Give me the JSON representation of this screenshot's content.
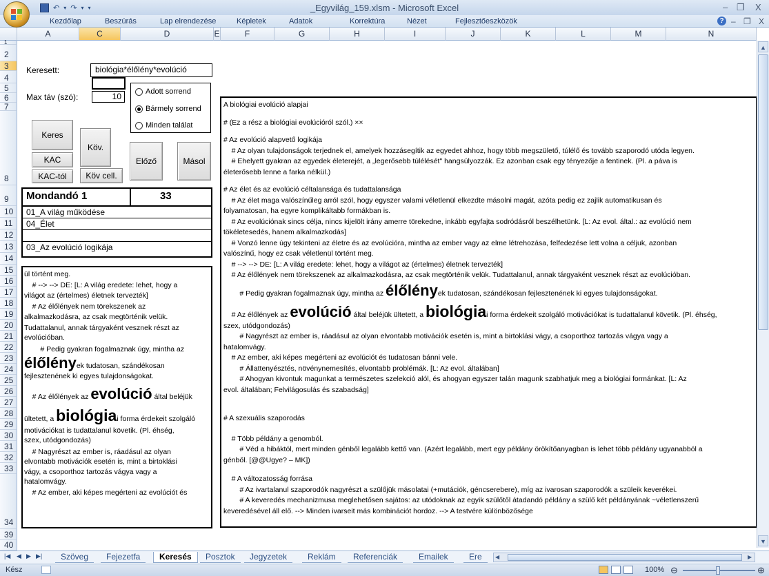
{
  "window": {
    "title": "_Egyvilág_159.xlsm - Microsoft Excel",
    "minimize": "–",
    "restore": "❐",
    "close": "X"
  },
  "ribbon": {
    "tabs": [
      "Kezdőlap",
      "Beszúrás",
      "Lap elrendezése",
      "Képletek",
      "Adatok",
      "Korrektúra",
      "Nézet",
      "Fejlesztőeszközök"
    ],
    "help": "?"
  },
  "columns": [
    "A",
    "C",
    "D",
    "E",
    "F",
    "G",
    "H",
    "I",
    "J",
    "K",
    "L",
    "M",
    "N"
  ],
  "rows": [
    "1",
    "2",
    "3",
    "4",
    "5",
    "6",
    "7",
    "8",
    "9",
    "10",
    "11",
    "12",
    "13",
    "14",
    "15",
    "16",
    "17",
    "18",
    "19",
    "20",
    "21",
    "22",
    "23",
    "24",
    "25",
    "26",
    "27",
    "28",
    "29",
    "30",
    "31",
    "32",
    "33",
    "34",
    "39",
    "40"
  ],
  "search": {
    "label": "Keresett:",
    "value": "biológia*élőlény*evolúció",
    "maxdist_label": "Max táv (szó):",
    "maxdist_value": "10"
  },
  "radios": {
    "options": [
      "Adott sorrend",
      "Bármely sorrend",
      "Minden találat"
    ],
    "selected": 1
  },
  "buttons": {
    "keres": "Keres",
    "kov": "Köv.",
    "kac": "KAC",
    "elozo": "Előző",
    "masol": "Másol",
    "kactol": "KAC-tól",
    "kovcell": "Köv cell."
  },
  "mondando": {
    "label": "Mondandó 1",
    "count": "33",
    "items": [
      "01_A világ működése",
      "04_Élet",
      "",
      "03_Az evolúció logikája"
    ]
  },
  "left_panel": {
    "lines": [
      "ül történt meg.",
      "    # --> --> DE: [L: A világ eredete: lehet, hogy a",
      "világot az (értelmes) életnek tervezték]",
      "    # Az élőlények nem törekszenek az",
      "alkalmazkodásra, az csak megtörténik velük.",
      "Tudattalanul, annak tárgyaként vesznek részt az",
      "evolúcióban.",
      "        # Pedig gyakran fogalmaznak úgy, mintha az"
    ],
    "w_elolenye": "élőlény",
    "line_after_elolenye": "ek tudatosan, szándékosan",
    "line_fejl": "fejlesztenének ki egyes tulajdonságokat.",
    "line_az_pre": "    # Az élőlények az ",
    "w_evolucio": "evolúció",
    "line_az_post": " által beléjük",
    "line_ultet_pre": "ültetett, a ",
    "w_biologia": "biológia",
    "line_ultet_post": "i forma érdekeit szolgáló",
    "tail_lines": [
      "motivációkat is tudattalanul követik. (Pl. éhség,",
      "szex, utódgondozás)",
      "    # Nagyrészt az ember is, ráadásul az olyan",
      "elvontabb motivációk esetén is, mint a birtoklási",
      "vágy, a csoporthoz tartozás vágya vagy a",
      "hatalomvágy.",
      "    # Az ember, aki képes megérteni az evolúciót és"
    ]
  },
  "main_panel": {
    "p1": "A biológiai evolúció alapjai",
    "p2": "# (Ez a rész a biológiai evolúcióról szól.) ××",
    "p3": "# Az evolúció alapvető logikája\n    # Az olyan tulajdonságok terjednek el, amelyek hozzásegítik az egyedet ahhoz, hogy több megszülető, túlélő és tovább szaporodó utóda legyen.\n    # Ehelyett gyakran az egyedek életerejét, a „legerősebb túlélését\" hangsúlyozzák. Ez azonban csak egy tényezője a fentinek. (Pl. a páva is\néleterősebb lenne a farka nélkül.)",
    "p4": "# Az élet és az evolúció céltalansága és tudattalansága\n    # Az élet maga valószínűleg arról szól, hogy egyszer valami véletlenül elkezdte másolni magát, azóta pedig ez zajlik automatikusan és\nfolyamatosan, ha egyre komplikáltabb formákban is.\n    # Az evolúciónak sincs célja, nincs kijelölt irány amerre törekedne, inkább egyfajta sodródásról beszélhetünk. [L: Az evol. által.: az evolúció nem\ntökéletesedés, hanem alkalmazkodás]\n    # Vonzó lenne úgy tekinteni az életre és az evolúcióra, mintha az ember vagy az elme létrehozása, felfedezése lett volna a céljuk, azonban\nvalószínű, hogy ez csak véletlenül történt meg.\n    # --> --> DE: [L: A világ eredete: lehet, hogy a világot az (értelmes) életnek tervezték]\n    # Az élőlények nem törekszenek az alkalmazkodásra, az csak megtörténik velük. Tudattalanul, annak tárgyaként vesznek részt az evolúcióban.",
    "l_pedig_pre": "        # Pedig gyakran fogalmaznak úgy, mintha az ",
    "l_pedig_word": "élőlény",
    "l_pedig_post": "ek tudatosan, szándékosan fejlesztenének ki egyes tulajdonságokat.",
    "l_az_pre": "    # Az élőlények az ",
    "l_az_word1": "evolúció",
    "l_az_mid": " által beléjük ültetett, a ",
    "l_az_word2": "biológia",
    "l_az_post": "i forma érdekeit szolgáló motivációkat is tudattalanul követik. (Pl. éhség,",
    "p5": "szex, utódgondozás)\n        # Nagyrészt az ember is, ráadásul az olyan elvontabb motivációk esetén is, mint a birtoklási vágy, a csoporthoz tartozás vágya vagy a\nhatalomvágy.\n    # Az ember, aki képes megérteni az evolúciót és tudatosan bánni vele.\n        # Állattenyésztés, növénynemesítés, elvontabb problémák. [L: Az evol. általában]\n        # Ahogyan kivontuk magunkat a természetes szelekció alól, és ahogyan egyszer talán magunk szabhatjuk meg a biológiai formánkat. [L: Az\nevol. általában; Felvilágosulás és szabadság]",
    "p6": "# A szexuális szaporodás",
    "p7": "    # Több példány a genomból.\n        # Véd a hibáktól, mert minden génből legalább kettő van. (Azért legalább, mert egy példány örökítőanyagban is lehet több példány ugyanabból a\ngénből. [@@Ugye? – MK])",
    "p8": "    # A változatosság forrása\n        # Az ivartalanul szaporodók nagyrészt a szülőjük másolatai (+mutációk, géncserebere), míg az ivarosan szaporodók a szüleik keverékei.\n        # A keveredés mechanizmusa meglehetősen sajátos: az utódoknak az egyik szülőtől átadandó példány a szülő két példányának ~véletlenszerű\nkeveredésével áll elő. --> Minden ivarseit más kombinációt hordoz. --> A testvére különbözősége"
  },
  "sheet_tabs": {
    "items": [
      "Szöveg",
      "Fejezetfa",
      "Keresés",
      "Posztok",
      "Jegyzetek",
      "Reklám",
      "Referenciák",
      "Emailek",
      "Ere"
    ],
    "active": "Keresés"
  },
  "status": {
    "ready": "Kész",
    "zoom": "100%"
  }
}
